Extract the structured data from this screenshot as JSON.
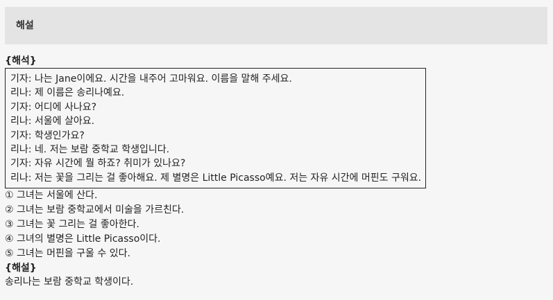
{
  "header": {
    "title": "해설"
  },
  "translation": {
    "label": "{해석}",
    "dialogue": [
      "기자: 나는 Jane이에요. 시간을 내주어 고마워요. 이름을 말해 주세요.",
      "리나: 제 이름은 송리나예요.",
      "기자: 어디에 사나요?",
      "리나: 서울에 살아요.",
      "기자: 학생인가요?",
      "리나: 네. 저는 보람 중학교 학생입니다.",
      "기자: 자유 시간에 뭘 하죠? 취미가 있나요?",
      "리나: 저는 꽃을 그리는 걸 좋아해요. 제 별명은 Little Picasso예요. 저는 자유 시간에 머핀도 구워요."
    ]
  },
  "options": [
    "① 그녀는 서울에 산다.",
    "② 그녀는 보람 중학교에서 미술을 가르친다.",
    "③ 그녀는 꽃 그리는 걸 좋아한다.",
    "④ 그녀의 별명은 Little Picasso이다.",
    "⑤ 그녀는 머핀을 구울 수 있다."
  ],
  "explanation": {
    "label": "{해설}",
    "text": "송리나는 보람 중학교 학생이다."
  }
}
